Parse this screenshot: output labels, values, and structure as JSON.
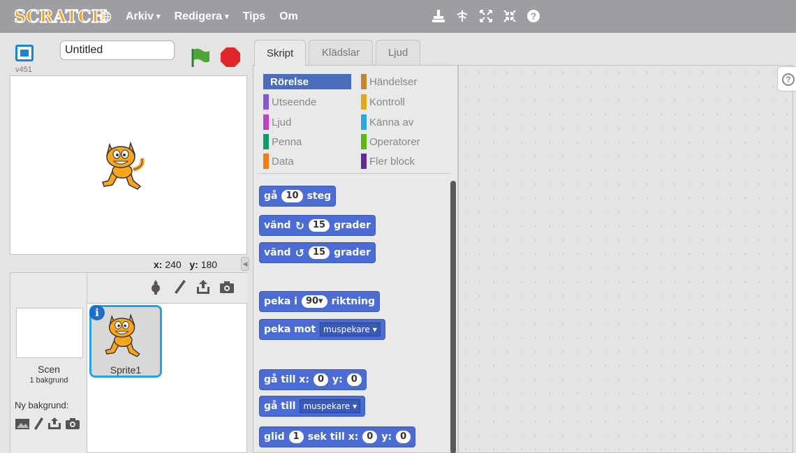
{
  "menubar": {
    "logo": "SCRATCH",
    "items": [
      {
        "label": "Arkiv",
        "caret": "▾"
      },
      {
        "label": "Redigera",
        "caret": "▾"
      },
      {
        "label": "Tips",
        "caret": ""
      },
      {
        "label": "Om",
        "caret": ""
      }
    ],
    "tools": [
      "duplicate-icon",
      "delete-icon",
      "grow-icon",
      "shrink-icon",
      "help-icon"
    ]
  },
  "stage": {
    "version": "v451",
    "title_value": "Untitled",
    "x_label": "x:",
    "x_value": "240",
    "y_label": "y:",
    "y_value": "180"
  },
  "sprites": {
    "scene_label": "Scen",
    "scene_sub": "1 bakgrund",
    "new_backdrop_label": "Ny bakgrund:",
    "sprite_name": "Sprite1",
    "info": "i"
  },
  "tabs": [
    "Skript",
    "Klädslar",
    "Ljud"
  ],
  "categories": [
    {
      "label": "Rörelse",
      "color": "#4a6cd4",
      "active": true
    },
    {
      "label": "Händelser",
      "color": "#c88330"
    },
    {
      "label": "Utseende",
      "color": "#8a55d7"
    },
    {
      "label": "Kontroll",
      "color": "#e1a91a"
    },
    {
      "label": "Ljud",
      "color": "#bb42c3"
    },
    {
      "label": "Känna av",
      "color": "#2ca5e2"
    },
    {
      "label": "Penna",
      "color": "#0e9a6c"
    },
    {
      "label": "Operatorer",
      "color": "#5cb712"
    },
    {
      "label": "Data",
      "color": "#ee7d16"
    },
    {
      "label": "Fler block",
      "color": "#632d99"
    }
  ],
  "blocks": {
    "move": {
      "a": "gå",
      "n": "10",
      "b": "steg"
    },
    "turn_right": {
      "a": "vänd",
      "n": "15",
      "b": "grader"
    },
    "turn_left": {
      "a": "vänd",
      "n": "15",
      "b": "grader"
    },
    "point_dir": {
      "a": "peka i",
      "n": "90▾",
      "b": "riktning"
    },
    "point_towards": {
      "a": "peka mot",
      "d": "muspekare"
    },
    "goto_xy": {
      "a": "gå till x:",
      "x": "0",
      "b": "y:",
      "y": "0"
    },
    "goto": {
      "a": "gå till",
      "d": "muspekare"
    },
    "glide": {
      "a": "glid",
      "n": "1",
      "b": "sek till x:",
      "x": "0",
      "c": "y:",
      "y": "0"
    }
  },
  "colors": {
    "motion": "#4a6cd4",
    "menubar": "#9c9ea2",
    "selection": "#26a3e0"
  }
}
